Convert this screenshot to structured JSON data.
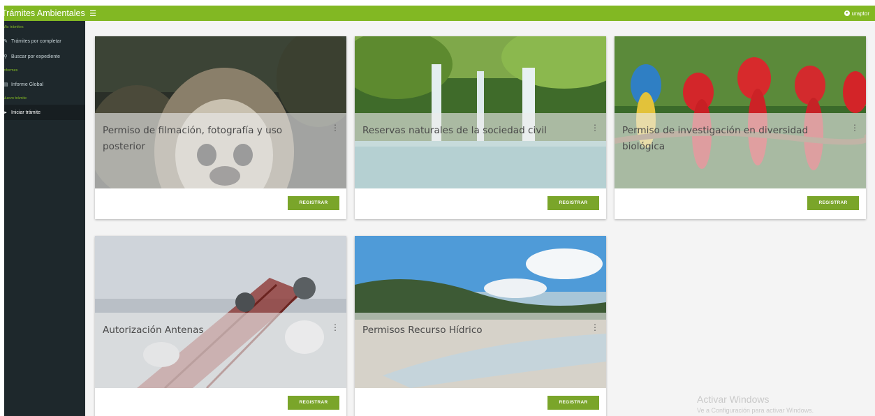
{
  "app": {
    "title": "Trámites Ambientales",
    "menu_icon": "hamburger-icon"
  },
  "user": {
    "name": "uraptor",
    "icon": "user-circle-icon"
  },
  "sidebar": {
    "sections": [
      {
        "header": "Mis trámites",
        "items": [
          {
            "label": "Trámites por completar",
            "icon": "edit-icon"
          },
          {
            "label": "Buscar por expediente",
            "icon": "search-icon"
          }
        ]
      },
      {
        "header": "Informes",
        "items": [
          {
            "label": "Informe Global",
            "icon": "bar-chart-icon"
          }
        ]
      },
      {
        "header": "Nuevo trámite",
        "items": [
          {
            "label": "Iniciar trámite",
            "icon": "play-icon"
          }
        ]
      }
    ]
  },
  "cards": [
    {
      "title": "Permiso de filmación, fotografía y uso posterior",
      "button": "REGISTRAR",
      "image": "monkey-photo"
    },
    {
      "title": "Reservas naturales de la sociedad civil",
      "button": "REGISTRAR",
      "image": "waterfall-photo"
    },
    {
      "title": "Permiso de investigación en diversidad biológica",
      "button": "REGISTRAR",
      "image": "macaws-photo"
    },
    {
      "title": "Autorización Antenas",
      "button": "REGISTRAR",
      "image": "antenna-tower-photo"
    },
    {
      "title": "Permisos Recurso Hídrico",
      "button": "REGISTRAR",
      "image": "lake-landscape-photo"
    }
  ],
  "watermark": {
    "line1": "Activar Windows",
    "line2": "Ve a Configuración para activar Windows."
  },
  "colors": {
    "accent": "#82b823",
    "sidebar": "#1e282c",
    "button": "#7aa52a"
  }
}
